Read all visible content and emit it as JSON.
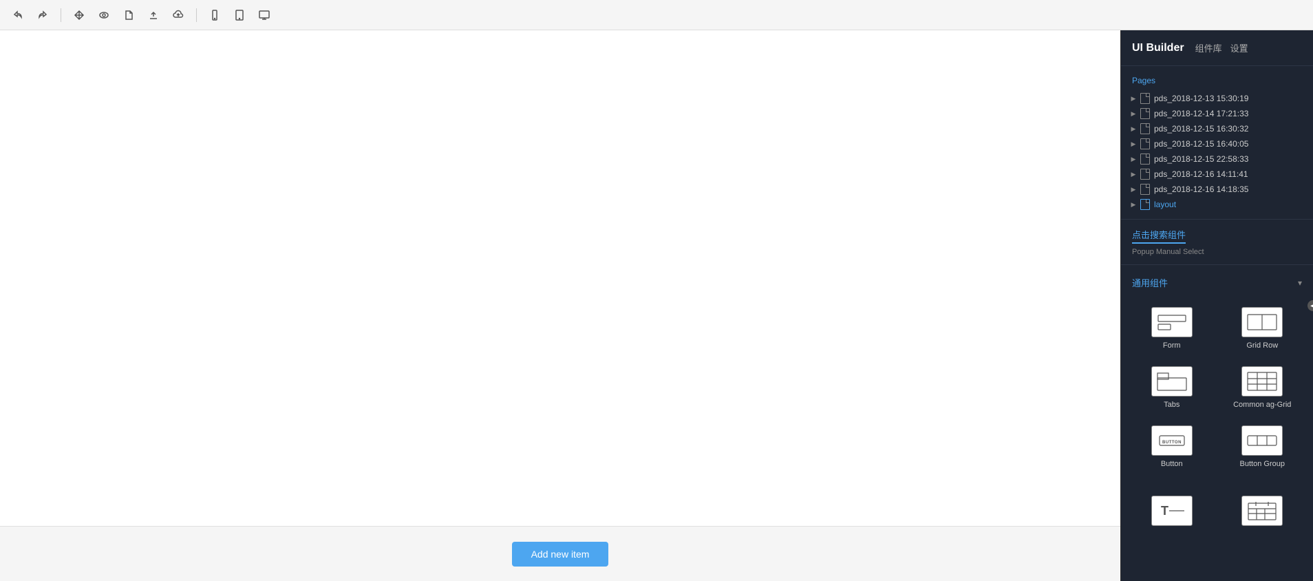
{
  "toolbar": {
    "undo_label": "↩",
    "redo_label": "↪",
    "icons": [
      "undo",
      "redo",
      "move",
      "eye",
      "file",
      "upload",
      "cloud-upload",
      "mobile",
      "tablet",
      "desktop"
    ]
  },
  "header": {
    "title": "UI Builder",
    "tab_components": "组件库",
    "tab_settings": "设置"
  },
  "pages": {
    "label": "Pages",
    "items": [
      {
        "name": "pds_2018-12-13 15:30:19",
        "active": false
      },
      {
        "name": "pds_2018-12-14 17:21:33",
        "active": false
      },
      {
        "name": "pds_2018-12-15 16:30:32",
        "active": false
      },
      {
        "name": "pds_2018-12-15 16:40:05",
        "active": false
      },
      {
        "name": "pds_2018-12-15 22:58:33",
        "active": false
      },
      {
        "name": "pds_2018-12-16 14:11:41",
        "active": false
      },
      {
        "name": "pds_2018-12-16 14:18:35",
        "active": false
      },
      {
        "name": "layout",
        "active": true
      }
    ]
  },
  "search": {
    "label": "点击搜索组件",
    "hint": "Popup Manual Select"
  },
  "components": {
    "section_label": "通用组件",
    "items": [
      {
        "id": "form",
        "label": "Form",
        "icon_type": "form"
      },
      {
        "id": "grid-row",
        "label": "Grid Row",
        "icon_type": "grid-row"
      },
      {
        "id": "tabs",
        "label": "Tabs",
        "icon_type": "tabs"
      },
      {
        "id": "ag-grid",
        "label": "Common ag-Grid",
        "icon_type": "ag-grid"
      },
      {
        "id": "button",
        "label": "Button",
        "icon_type": "button"
      },
      {
        "id": "button-group",
        "label": "Button Group",
        "icon_type": "button-group"
      }
    ]
  },
  "canvas": {
    "add_button_label": "Add new item"
  }
}
